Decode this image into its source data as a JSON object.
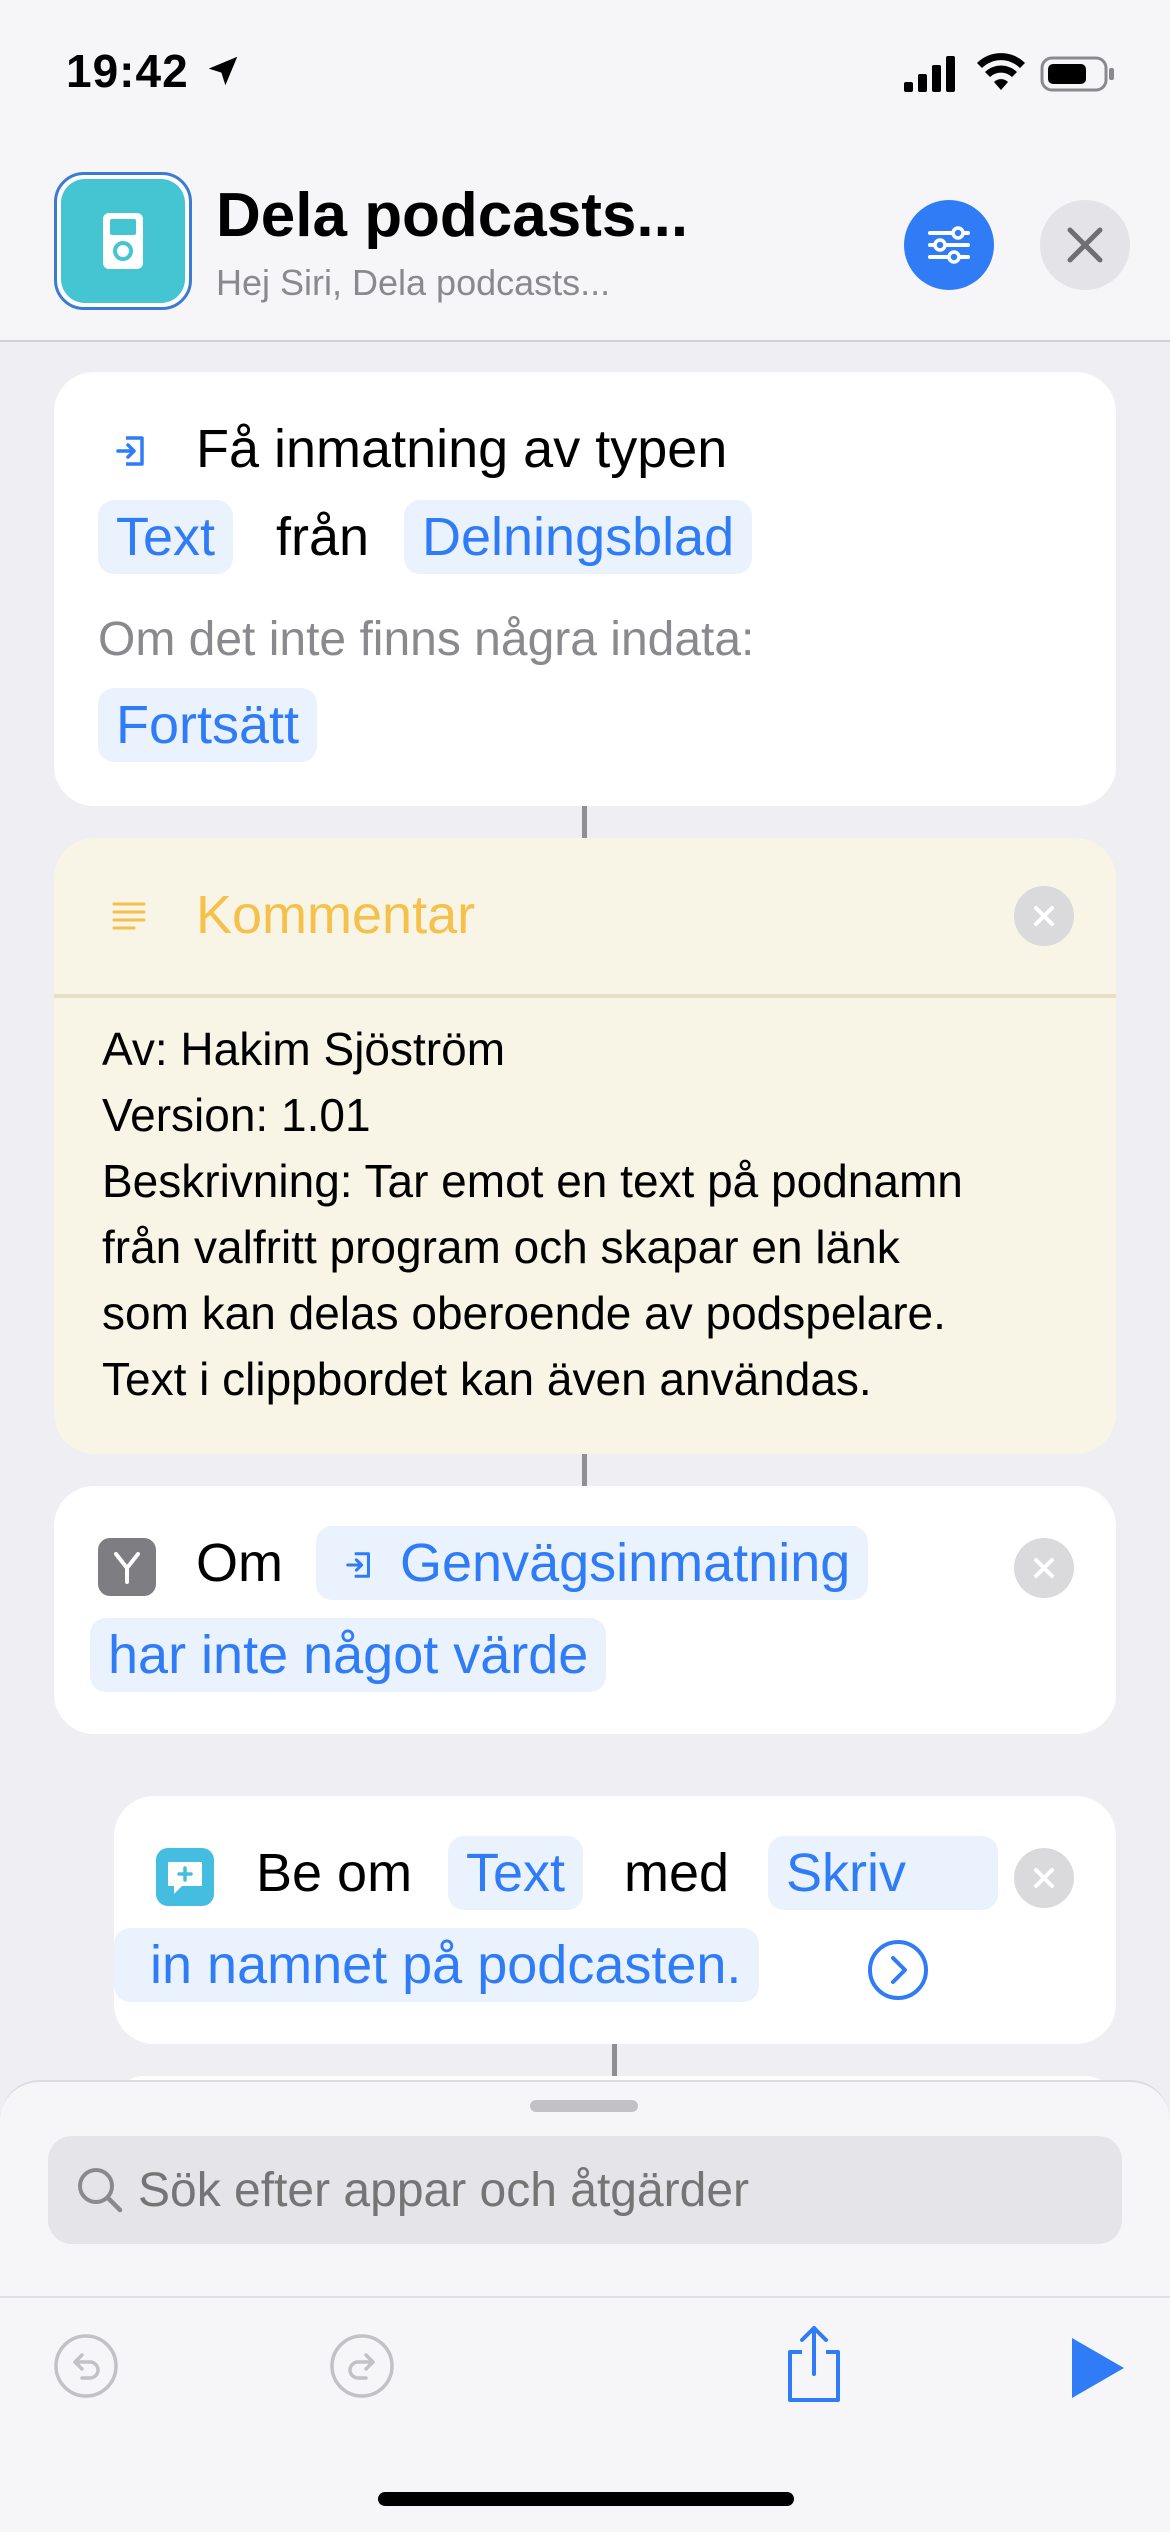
{
  "status_bar": {
    "time": "19:42"
  },
  "header": {
    "title": "Dela podcasts...",
    "subtitle": "Hej Siri, Dela podcasts..."
  },
  "action_get_input": {
    "title": "Få inmatning av typen",
    "type_value": "Text",
    "from_label": "från",
    "source_value": "Delningsblad",
    "no_input_label": "Om det inte finns några indata:",
    "no_input_value": "Fortsätt"
  },
  "comment": {
    "title": "Kommentar",
    "lines": [
      "Av: Hakim Sjöström",
      "Version: 1.01",
      "Beskrivning: Tar emot en text på podnamn",
      "från valfritt program och skapar en länk",
      "som kan delas oberoende av podspelare.",
      "Text i clippbordet kan även användas."
    ]
  },
  "if_action": {
    "label": "Om",
    "variable": "Genvägsinmatning",
    "condition": "har inte något värde"
  },
  "ask_action": {
    "label": "Be om",
    "type_value": "Text",
    "with_label": "med",
    "prompt_part1": "Skriv",
    "prompt_part2": "in namnet på podcasten."
  },
  "search": {
    "placeholder": "Sök efter appar och åtgärder"
  },
  "icons": {
    "location": "location-arrow-icon",
    "signal": "cellular-signal-icon",
    "wifi": "wifi-icon",
    "battery": "battery-icon",
    "settings": "sliders-icon",
    "close": "close-icon",
    "input": "input-arrow-icon",
    "comment": "lines-icon",
    "if": "branch-icon",
    "ask": "speech-bubble-plus-icon",
    "undo": "undo-icon",
    "redo": "redo-icon",
    "share": "share-icon",
    "play": "play-icon"
  },
  "colors": {
    "accent": "#2f7cf6",
    "comment_title": "#f5c14a",
    "comment_bg": "#f8f4e6",
    "app_icon": "#45c4d2"
  }
}
